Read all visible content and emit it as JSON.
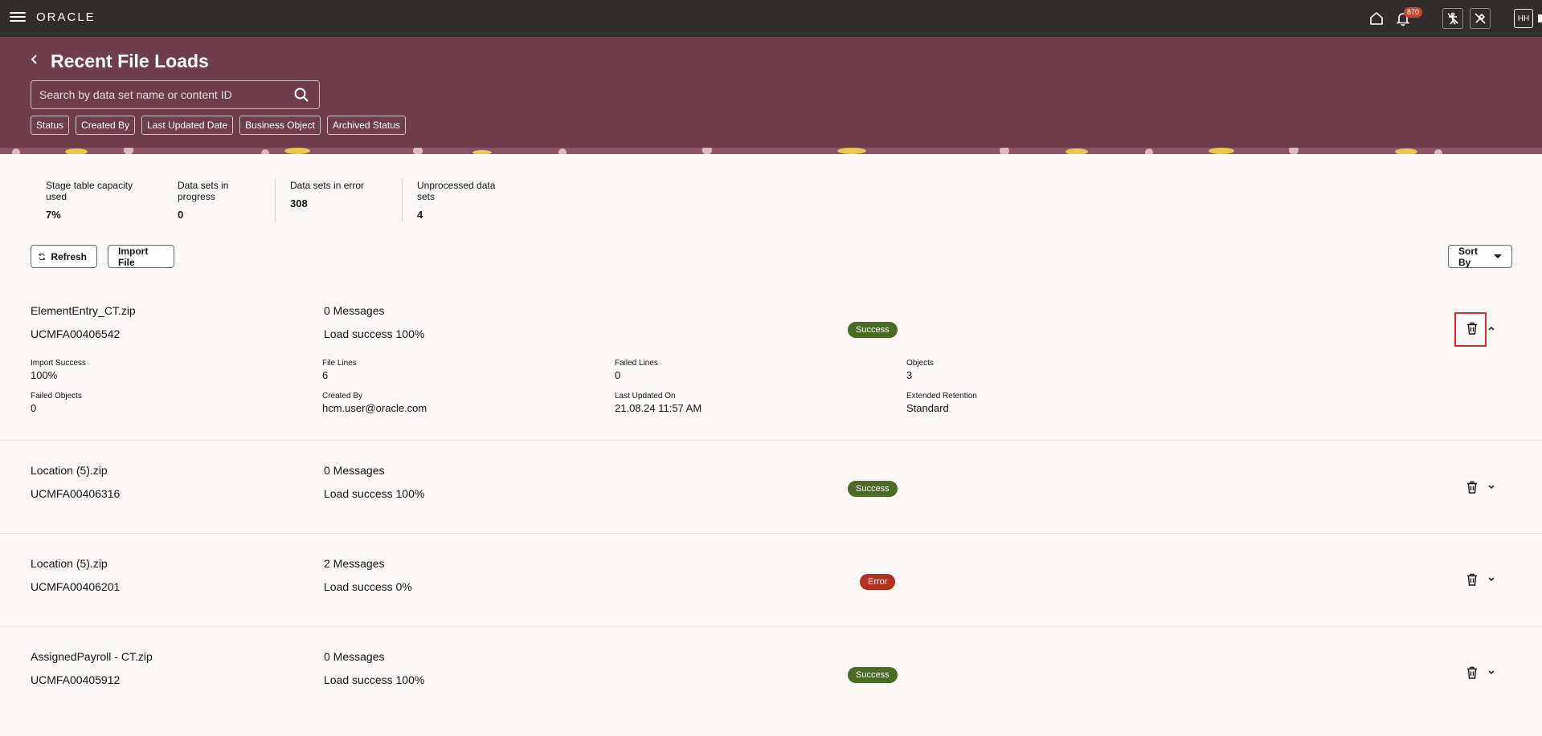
{
  "topbar": {
    "brand": "ORACLE",
    "notifications_count": "870",
    "avatar_initials": "HH"
  },
  "header": {
    "title": "Recent File Loads",
    "search_placeholder": "Search by data set name or content ID",
    "filters": [
      "Status",
      "Created By",
      "Last Updated Date",
      "Business Object",
      "Archived Status"
    ]
  },
  "stats": [
    {
      "label": "Stage table capacity used",
      "value": "7%"
    },
    {
      "label": "Data sets in progress",
      "value": "0"
    },
    {
      "label": "Data sets in error",
      "value": "308"
    },
    {
      "label": "Unprocessed data sets",
      "value": "4"
    }
  ],
  "toolbar": {
    "refresh_label": "Refresh",
    "import_label": "Import File",
    "sort_label": "Sort By"
  },
  "rows": [
    {
      "name": "ElementEntry_CT.zip",
      "id": "UCMFA00406542",
      "messages": "0 Messages",
      "load": "Load success 100%",
      "status": "Success",
      "expanded": true,
      "details": [
        {
          "label": "Import Success",
          "value": "100%"
        },
        {
          "label": "File Lines",
          "value": "6"
        },
        {
          "label": "Failed Lines",
          "value": "0"
        },
        {
          "label": "Objects",
          "value": "3"
        },
        {
          "label": "Failed Objects",
          "value": "0"
        },
        {
          "label": "Created By",
          "value": "hcm.user@oracle.com"
        },
        {
          "label": "Last Updated On",
          "value": "21.08.24 11:57 AM"
        },
        {
          "label": "Extended Retention",
          "value": "Standard"
        }
      ]
    },
    {
      "name": "Location (5).zip",
      "id": "UCMFA00406316",
      "messages": "0 Messages",
      "load": "Load success 100%",
      "status": "Success"
    },
    {
      "name": "Location (5).zip",
      "id": "UCMFA00406201",
      "messages": "2 Messages",
      "load": "Load success 0%",
      "status": "Error"
    },
    {
      "name": "AssignedPayroll - CT.zip",
      "id": "UCMFA00405912",
      "messages": "0 Messages",
      "load": "Load success 100%",
      "status": "Success"
    }
  ],
  "colors": {
    "header_bg": "#6f3e4c",
    "topbar_bg": "#312d2a",
    "success": "#4a6b26",
    "error": "#b3311f"
  }
}
